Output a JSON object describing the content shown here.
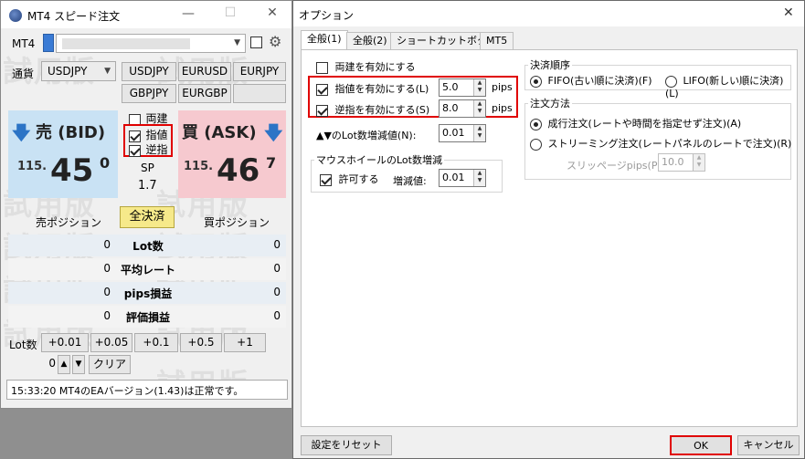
{
  "left": {
    "title": "MT4 スピード注文",
    "mt4_label": "MT4",
    "currency_label": "通貨",
    "symbol_selected": "USDJPY",
    "symbol_buttons": [
      "USDJPY",
      "EURUSD",
      "EURJPY",
      "GBPJPY",
      "EURGBP"
    ],
    "watermark": "試用版",
    "bid_label": "売 (BID)",
    "ask_label": "買 (ASK)",
    "checks": [
      {
        "label": "両建",
        "checked": false
      },
      {
        "label": "指値",
        "checked": true
      },
      {
        "label": "逆指",
        "checked": true
      }
    ],
    "bid_price_prefix": "115.",
    "bid_price_main": "45",
    "bid_price_sup": "0",
    "ask_price_prefix": "115.",
    "ask_price_main": "46",
    "ask_price_sup": "7",
    "sp_label": "SP",
    "sp_value": "1.7",
    "sell_position_label": "売ポジション",
    "close_all_label": "全決済",
    "buy_position_label": "買ポジション",
    "rows": [
      {
        "label": "Lot数",
        "sell": "0",
        "buy": "0"
      },
      {
        "label": "平均レート",
        "sell": "0",
        "buy": "0"
      },
      {
        "label": "pips損益",
        "sell": "0",
        "buy": "0"
      },
      {
        "label": "評価損益",
        "sell": "0",
        "buy": "0"
      }
    ],
    "lot_label": "Lot数",
    "lot_buttons": [
      "+0.01",
      "+0.05",
      "+0.1",
      "+0.5",
      "+1"
    ],
    "lot_value": "0",
    "clear_label": "クリア",
    "status_text": "15:33:20 MT4のEAバージョン(1.43)は正常です。"
  },
  "dialog": {
    "title": "オプション",
    "tabs": [
      "全般(1)",
      "全般(2)",
      "ショートカットボタン",
      "MT5"
    ],
    "hedge_label": "両建を有効にする",
    "limit_label": "指値を有効にする(L)",
    "limit_value": "5.0",
    "stop_label": "逆指を有効にする(S)",
    "stop_value": "8.0",
    "pips_unit": "pips",
    "lot_step_label": "▲▼のLot数増減値(N):",
    "lot_step_value": "0.01",
    "wheel_group_title": "マウスホイールのLot数増減",
    "wheel_allow_label": "許可する",
    "wheel_step_label": "増減値:",
    "wheel_step_value": "0.01",
    "settle_group_title": "決済順序",
    "fifo_label": "FIFO(古い順に決済)(F)",
    "lifo_label": "LIFO(新しい順に決済)(L)",
    "order_group_title": "注文方法",
    "market_label": "成行注文(レートや時間を指定せず注文)(A)",
    "stream_label": "ストリーミング注文(レートパネルのレートで注文)(R)",
    "slippage_label": "スリッページpips(P):",
    "slippage_value": "10.0",
    "reset_label": "設定をリセット",
    "ok_label": "OK",
    "cancel_label": "キャンセル"
  }
}
